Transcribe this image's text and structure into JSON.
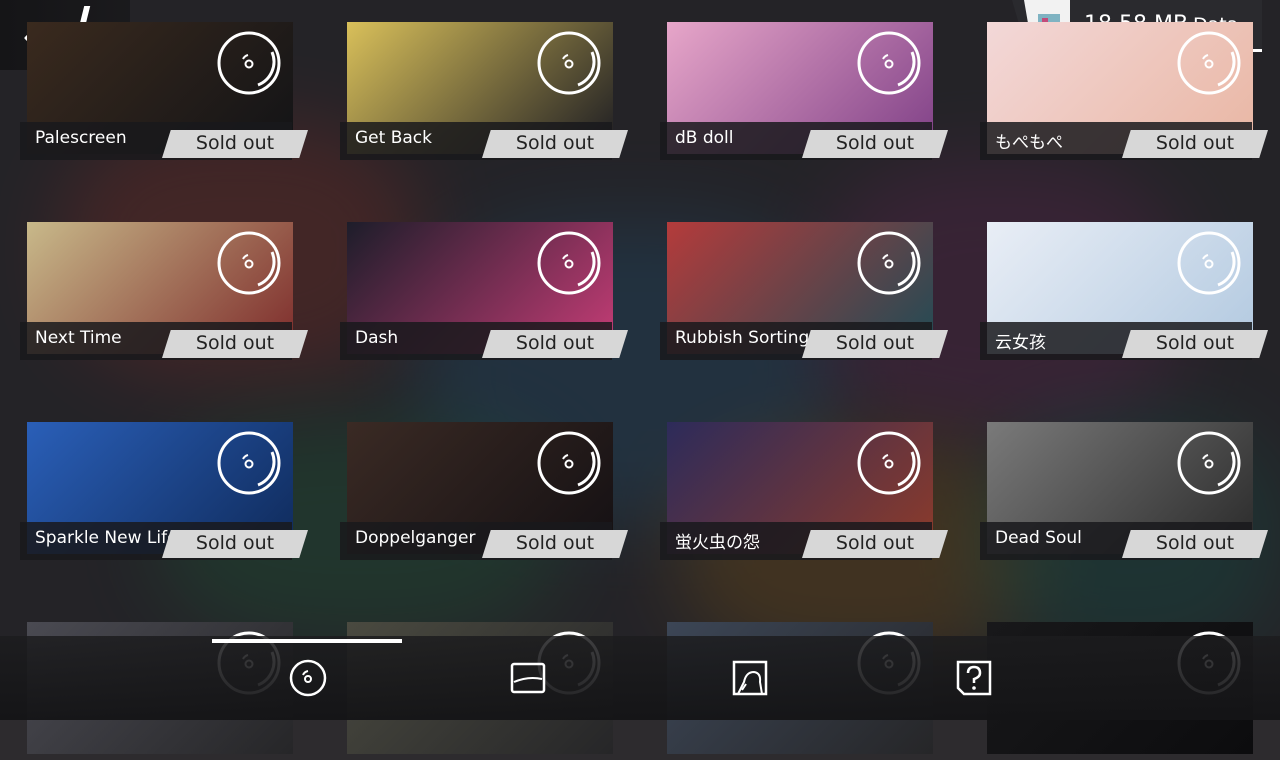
{
  "header": {
    "data_value": "18.58 MB",
    "data_label": "Data"
  },
  "songs": [
    {
      "title": "Palescreen",
      "status": "Sold out",
      "cover": [
        "#3a2a1e",
        "#121316"
      ]
    },
    {
      "title": "Get Back",
      "status": "Sold out",
      "cover": [
        "#d9c05a",
        "#1b1b22"
      ]
    },
    {
      "title": "dB doll",
      "status": "Sold out",
      "cover": [
        "#e7a6c9",
        "#7e3f86"
      ]
    },
    {
      "title": "もぺもぺ",
      "status": "Sold out",
      "cover": [
        "#f3d8d8",
        "#e9b6a3"
      ]
    },
    {
      "title": "Next Time",
      "status": "Sold out",
      "cover": [
        "#c8b98a",
        "#7d2a2a"
      ]
    },
    {
      "title": "Dash",
      "status": "Sold out",
      "cover": [
        "#1d1d2a",
        "#c73d77"
      ]
    },
    {
      "title": "Rubbish Sorting",
      "status": "Sold out",
      "cover": [
        "#b43b3b",
        "#1f4b55"
      ]
    },
    {
      "title": "云女孩",
      "status": "Sold out",
      "cover": [
        "#e9eef6",
        "#b2c9e0"
      ]
    },
    {
      "title": "Sparkle New Life",
      "status": "Sold out",
      "cover": [
        "#2a5fb8",
        "#0f2a5a"
      ]
    },
    {
      "title": "Doppelganger",
      "status": "Sold out",
      "cover": [
        "#3a2a24",
        "#141013"
      ]
    },
    {
      "title": "蛍火虫の怨",
      "status": "Sold out",
      "cover": [
        "#2d2b5a",
        "#8d3b2a"
      ]
    },
    {
      "title": "Dead Soul",
      "status": "Sold out",
      "cover": [
        "#7a7a7a",
        "#2a2a2a"
      ]
    }
  ],
  "partial_row": [
    {
      "cover": [
        "#4a4a52",
        "#262628"
      ]
    },
    {
      "cover": [
        "#4a4a40",
        "#262628"
      ]
    },
    {
      "cover": [
        "#3c4656",
        "#262628"
      ]
    },
    {
      "cover": [
        "#18181a",
        "#0c0c0e"
      ]
    }
  ],
  "bottom_tabs": [
    {
      "icon": "disc-icon",
      "active": true
    },
    {
      "icon": "card-icon",
      "active": false
    },
    {
      "icon": "character-icon",
      "active": false
    },
    {
      "icon": "help-icon",
      "active": false
    }
  ],
  "colors": {
    "sold_badge_bg": "#d7d7d7",
    "sold_badge_text": "#222222",
    "accent": "#ffffff"
  }
}
